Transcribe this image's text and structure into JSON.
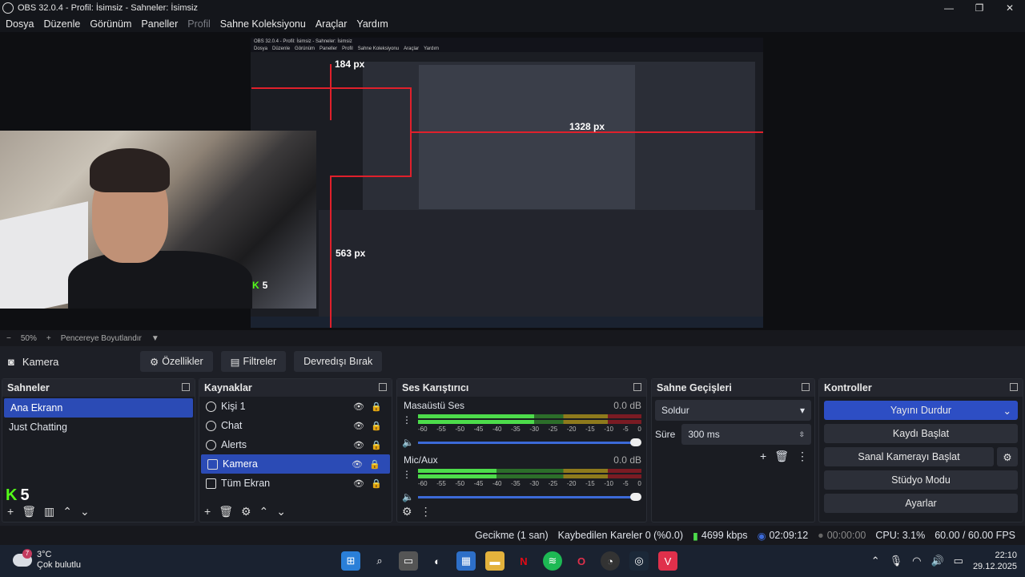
{
  "titlebar": {
    "title": "OBS 32.0.4 - Profil: İsimsiz - Sahneler: İsimsiz",
    "min": "—",
    "max": "❐",
    "close": "✕"
  },
  "menu": [
    "Dosya",
    "Düzenle",
    "Görünüm",
    "Paneller",
    "Profil",
    "Sahne Koleksiyonu",
    "Araçlar",
    "Yardım"
  ],
  "preview": {
    "mini_title": "OBS 32.0.4 - Profil: İsimsiz - Sahneler: İsimsiz",
    "measure_top": "184 px",
    "measure_right": "1328 px",
    "measure_bottom": "563 px",
    "kick_count": "5"
  },
  "zoom": {
    "minus": "−",
    "value": "50%",
    "plus": "+",
    "fit": "Pencereye Boyutlandır",
    "arrow": "▼"
  },
  "source_toolbar": {
    "source": "Kamera",
    "properties": "Özellikler",
    "filters": "Filtreler",
    "deactivate": "Devredışı Bırak"
  },
  "scenes": {
    "title": "Sahneler",
    "items": [
      "Ana Ekrann",
      "Just Chatting"
    ],
    "kick_count": "5"
  },
  "sources": {
    "title": "Kaynaklar",
    "items": [
      "Kişi 1",
      "Chat",
      "Alerts",
      "Kamera",
      "Tüm Ekran"
    ]
  },
  "mixer": {
    "title": "Ses Karıştırıcı",
    "channels": [
      {
        "name": "Masaüstü Ses",
        "db": "0.0 dB",
        "level": 0.52
      },
      {
        "name": "Mic/Aux",
        "db": "0.0 dB",
        "level": 0.35
      }
    ],
    "scale": [
      "-60",
      "-55",
      "-50",
      "-45",
      "-40",
      "-35",
      "-30",
      "-25",
      "-20",
      "-15",
      "-10",
      "-5",
      "0"
    ]
  },
  "transitions": {
    "title": "Sahne Geçişleri",
    "selected": "Soldur",
    "duration_label": "Süre",
    "duration": "300 ms"
  },
  "controls": {
    "title": "Kontroller",
    "stop_stream": "Yayını Durdur",
    "start_record": "Kaydı Başlat",
    "virtual_cam": "Sanal Kamerayı Başlat",
    "studio": "Stüdyo Modu",
    "settings": "Ayarlar"
  },
  "status": {
    "delay": "Gecikme (1 san)",
    "dropped": "Kaybedilen Kareler 0 (%0.0)",
    "bitrate": "4699 kbps",
    "stream_time": "02:09:12",
    "record_time": "00:00:00",
    "cpu": "CPU: 3.1%",
    "fps": "60.00 / 60.00 FPS"
  },
  "taskbar": {
    "temp": "3°C",
    "weather": "Çok bulutlu",
    "notif": "7",
    "time": "22:10",
    "date": "29.12.2025"
  }
}
